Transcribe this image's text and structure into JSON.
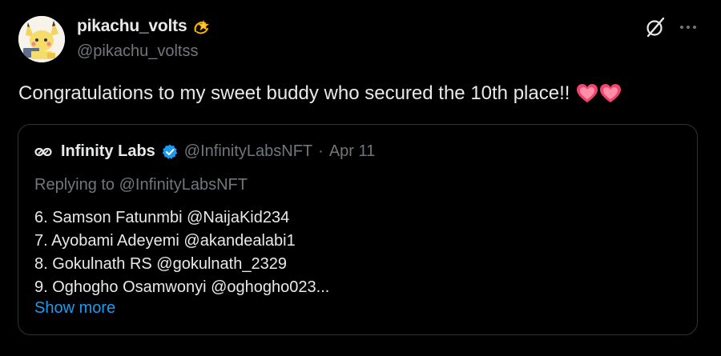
{
  "tweet": {
    "display_name": "pikachu_volts",
    "handle": "@pikachu_voltss",
    "text": "Congratulations to my sweet buddy who secured the 10th place!!",
    "name_emoji": "dizzy-star-emoji",
    "text_emoji": [
      "heart-emoji",
      "heart-emoji"
    ]
  },
  "actions": {
    "grok_icon": "grok-slash-icon",
    "more_icon": "more-horizontal-icon"
  },
  "quote": {
    "logo": "infinity-logo-icon",
    "name": "Infinity Labs",
    "verified_icon": "verified-badge-icon",
    "handle": "@InfinityLabsNFT",
    "separator": "·",
    "date": "Apr 11",
    "replying": "Replying to @InfinityLabsNFT",
    "lines": [
      "6. Samson Fatunmbi @NaijaKid234",
      "7. Ayobami Adeyemi @akandealabi1",
      "8. Gokulnath RS @gokulnath_2329",
      "9. Oghogho Osamwonyi @oghogho023..."
    ],
    "show_more": "Show more"
  },
  "colors": {
    "background": "#000000",
    "text_primary": "#e7e9ea",
    "text_secondary": "#71767b",
    "link": "#1d9bf0",
    "border": "#2f3336",
    "verified": "#1d9bf0",
    "heart": "#f4436c"
  }
}
